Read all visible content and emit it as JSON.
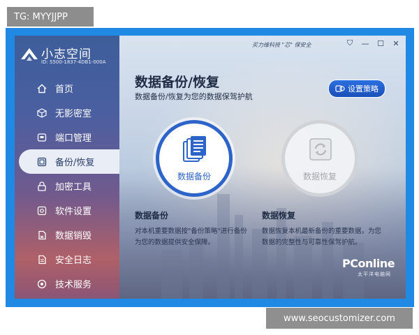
{
  "overlay": {
    "top_tag": "TG: MYYJJPP",
    "bottom_tag": "www.seocustomizer.com"
  },
  "app": {
    "name": "小志空间",
    "device_id": "ID: S500-1837-4DB1-000A",
    "slogan": "买力维科技 \"芯\" 保安全",
    "titlebar": [
      "⛉",
      "—",
      "☐",
      "✕"
    ]
  },
  "sidebar": {
    "items": [
      {
        "label": "首页",
        "icon": "home-icon"
      },
      {
        "label": "无影密室",
        "icon": "cube-icon"
      },
      {
        "label": "端口管理",
        "icon": "port-icon"
      },
      {
        "label": "备份/恢复",
        "icon": "backup-icon",
        "active": true
      },
      {
        "label": "加密工具",
        "icon": "lock-icon"
      },
      {
        "label": "软件设置",
        "icon": "settings-icon"
      },
      {
        "label": "数据销毁",
        "icon": "shred-icon"
      },
      {
        "label": "安全日志",
        "icon": "log-icon"
      },
      {
        "label": "技术服务",
        "icon": "support-icon"
      }
    ]
  },
  "main": {
    "title": "数据备份/恢复",
    "subtitle": "数据备份/恢复为您的数据保驾护航",
    "strategy_button": "设置策略",
    "backup": {
      "circle_label": "数据备份",
      "heading": "数据备份",
      "desc_line1": "对本机重要数据按\"备份策略\"进行备份",
      "desc_line2": "为您的数据提供安全保障。"
    },
    "restore": {
      "circle_label": "数据恢复",
      "heading": "数据恢复",
      "desc_line1": "数据恢复本机最新备份的重要数据，为您",
      "desc_line2": "数据的完整性与可靠性保驾护航。"
    }
  },
  "watermark": {
    "brand": "PConline",
    "sub": "太平洋电脑网"
  },
  "colors": {
    "accent": "#2c64c9",
    "frame": "#1f89e3"
  }
}
